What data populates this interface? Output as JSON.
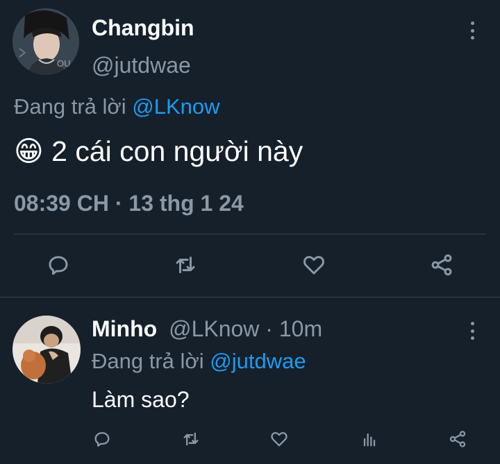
{
  "main_tweet": {
    "display_name": "Changbin",
    "handle": "@jutdwae",
    "avatar_text": "OU",
    "replying_prefix": "Đang trả lời",
    "replying_to": "@LKnow",
    "emoji": "😁",
    "text": "2 cái con người này",
    "timestamp": "08:39 CH · 13 thg 1 24"
  },
  "reply": {
    "display_name": "Minho",
    "handle": "@LKnow",
    "meta": "· 10m",
    "replying_prefix": "Đang trả lời",
    "replying_to": "@jutdwae",
    "text": "Làm sao?"
  },
  "icons": {
    "main_actions": [
      "reply-icon",
      "retweet-icon",
      "like-icon",
      "share-icon"
    ],
    "reply_actions": [
      "reply-icon",
      "retweet-icon",
      "like-icon",
      "views-icon",
      "share-icon"
    ]
  },
  "colors": {
    "background": "#15202b",
    "text": "#ffffff",
    "secondary": "#8b98a5",
    "accent": "#1d9bf0",
    "divider": "#38444d"
  }
}
